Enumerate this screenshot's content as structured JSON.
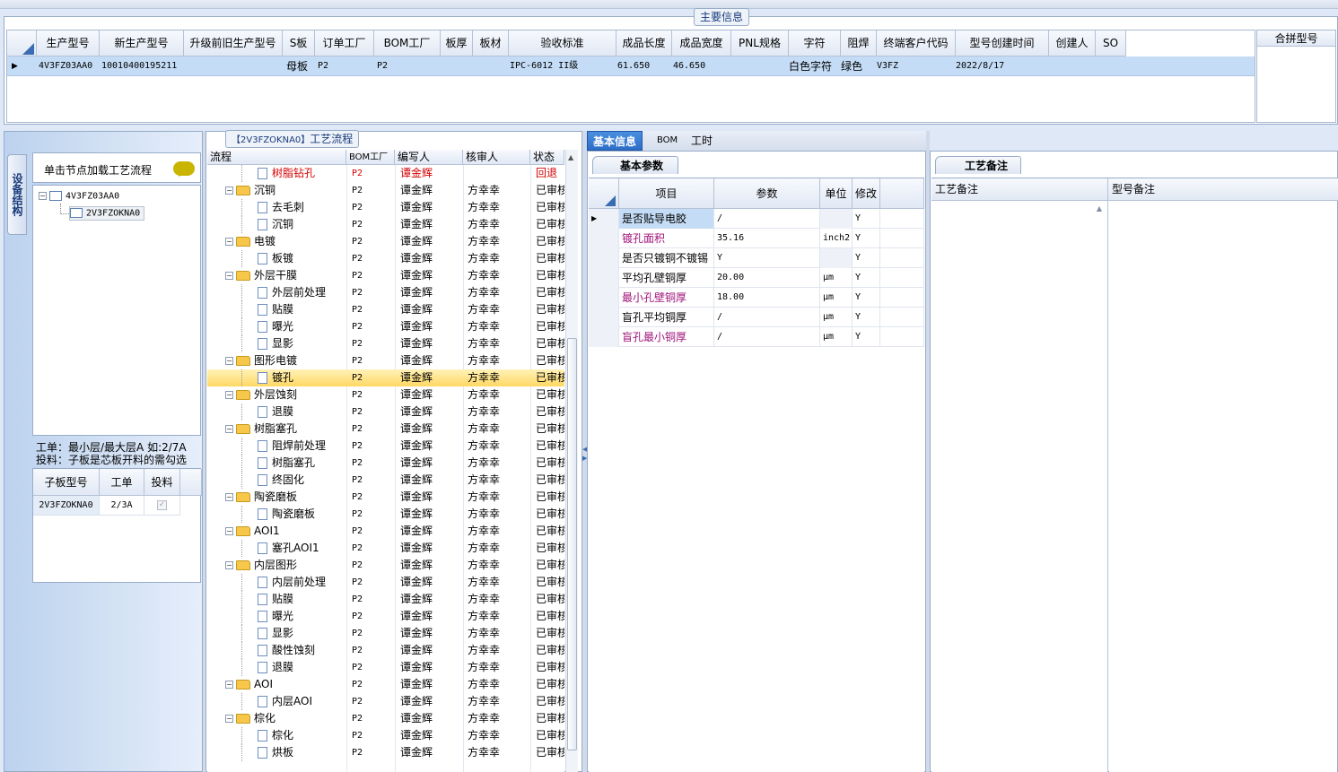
{
  "main": {
    "title": "主要信息",
    "columns": [
      "生产型号",
      "新生产型号",
      "升级前旧生产型号",
      "S板",
      "订单工厂",
      "BOM工厂",
      "板厚",
      "板材",
      "验收标准",
      "成品长度",
      "成品宽度",
      "PNL规格",
      "字符",
      "阻焊",
      "终端客户代码",
      "型号创建时间",
      "创建人",
      "SO"
    ],
    "row": {
      "model": "4V3FZ03AA0",
      "new_model": "10010400195211",
      "s_board": "母板",
      "order_factory": "P2",
      "bom_factory": "P2",
      "standard": "IPC-6012 II级",
      "length": "61.650",
      "width": "46.650",
      "character": "白色字符",
      "solder_mask": "绿色",
      "customer_code": "V3FZ",
      "created": "2022/8/17"
    },
    "merge_label": "合拼型号"
  },
  "left": {
    "vtab": "设备结构",
    "hint": "单击节点加载工艺流程",
    "tree": [
      "4V3FZ03AA0",
      "2V3FZOKNA0"
    ],
    "note_line1": "工单：最小层/最大层A 如:2/7A",
    "note_line2": "投料：子板是芯板开料的需勾选",
    "sub_columns": [
      "子板型号",
      "工单",
      "投料"
    ],
    "sub_row": {
      "model": "2V3FZOKNA0",
      "order": "2/3A"
    }
  },
  "flow": {
    "title_bracket": "【2V3FZOKNA0】",
    "title_text": "工艺流程",
    "columns": [
      "流程",
      "BOM工厂",
      "编写人",
      "核审人",
      "状态"
    ],
    "rows": [
      {
        "name": "树脂钻孔",
        "folder": false,
        "bom": "P2",
        "writer": "谭金辉",
        "reviewer": "",
        "status": "回退",
        "red": true
      },
      {
        "name": "沉铜",
        "folder": true,
        "bom": "P2",
        "writer": "谭金辉",
        "reviewer": "方幸幸",
        "status": "已审核"
      },
      {
        "name": "去毛刺",
        "folder": false,
        "bom": "P2",
        "writer": "谭金辉",
        "reviewer": "方幸幸",
        "status": "已审核"
      },
      {
        "name": "沉铜",
        "folder": false,
        "bom": "P2",
        "writer": "谭金辉",
        "reviewer": "方幸幸",
        "status": "已审核"
      },
      {
        "name": "电镀",
        "folder": true,
        "bom": "P2",
        "writer": "谭金辉",
        "reviewer": "方幸幸",
        "status": "已审核"
      },
      {
        "name": "板镀",
        "folder": false,
        "bom": "P2",
        "writer": "谭金辉",
        "reviewer": "方幸幸",
        "status": "已审核"
      },
      {
        "name": "外层干膜",
        "folder": true,
        "bom": "P2",
        "writer": "谭金辉",
        "reviewer": "方幸幸",
        "status": "已审核"
      },
      {
        "name": "外层前处理",
        "folder": false,
        "bom": "P2",
        "writer": "谭金辉",
        "reviewer": "方幸幸",
        "status": "已审核"
      },
      {
        "name": "贴膜",
        "folder": false,
        "bom": "P2",
        "writer": "谭金辉",
        "reviewer": "方幸幸",
        "status": "已审核"
      },
      {
        "name": "曝光",
        "folder": false,
        "bom": "P2",
        "writer": "谭金辉",
        "reviewer": "方幸幸",
        "status": "已审核"
      },
      {
        "name": "显影",
        "folder": false,
        "bom": "P2",
        "writer": "谭金辉",
        "reviewer": "方幸幸",
        "status": "已审核"
      },
      {
        "name": "图形电镀",
        "folder": true,
        "bom": "P2",
        "writer": "谭金辉",
        "reviewer": "方幸幸",
        "status": "已审核"
      },
      {
        "name": "镀孔",
        "folder": false,
        "bom": "P2",
        "writer": "谭金辉",
        "reviewer": "方幸幸",
        "status": "已审核",
        "selected": true
      },
      {
        "name": "外层蚀刻",
        "folder": true,
        "bom": "P2",
        "writer": "谭金辉",
        "reviewer": "方幸幸",
        "status": "已审核"
      },
      {
        "name": "退膜",
        "folder": false,
        "bom": "P2",
        "writer": "谭金辉",
        "reviewer": "方幸幸",
        "status": "已审核"
      },
      {
        "name": "树脂塞孔",
        "folder": true,
        "bom": "P2",
        "writer": "谭金辉",
        "reviewer": "方幸幸",
        "status": "已审核"
      },
      {
        "name": "阻焊前处理",
        "folder": false,
        "bom": "P2",
        "writer": "谭金辉",
        "reviewer": "方幸幸",
        "status": "已审核"
      },
      {
        "name": "树脂塞孔",
        "folder": false,
        "bom": "P2",
        "writer": "谭金辉",
        "reviewer": "方幸幸",
        "status": "已审核"
      },
      {
        "name": "终固化",
        "folder": false,
        "bom": "P2",
        "writer": "谭金辉",
        "reviewer": "方幸幸",
        "status": "已审核"
      },
      {
        "name": "陶瓷磨板",
        "folder": true,
        "bom": "P2",
        "writer": "谭金辉",
        "reviewer": "方幸幸",
        "status": "已审核"
      },
      {
        "name": "陶瓷磨板",
        "folder": false,
        "bom": "P2",
        "writer": "谭金辉",
        "reviewer": "方幸幸",
        "status": "已审核"
      },
      {
        "name": "AOI1",
        "folder": true,
        "bom": "P2",
        "writer": "谭金辉",
        "reviewer": "方幸幸",
        "status": "已审核"
      },
      {
        "name": "塞孔AOI1",
        "folder": false,
        "bom": "P2",
        "writer": "谭金辉",
        "reviewer": "方幸幸",
        "status": "已审核"
      },
      {
        "name": "内层图形",
        "folder": true,
        "bom": "P2",
        "writer": "谭金辉",
        "reviewer": "方幸幸",
        "status": "已审核"
      },
      {
        "name": "内层前处理",
        "folder": false,
        "bom": "P2",
        "writer": "谭金辉",
        "reviewer": "方幸幸",
        "status": "已审核"
      },
      {
        "name": "贴膜",
        "folder": false,
        "bom": "P2",
        "writer": "谭金辉",
        "reviewer": "方幸幸",
        "status": "已审核"
      },
      {
        "name": "曝光",
        "folder": false,
        "bom": "P2",
        "writer": "谭金辉",
        "reviewer": "方幸幸",
        "status": "已审核"
      },
      {
        "name": "显影",
        "folder": false,
        "bom": "P2",
        "writer": "谭金辉",
        "reviewer": "方幸幸",
        "status": "已审核"
      },
      {
        "name": "酸性蚀刻",
        "folder": false,
        "bom": "P2",
        "writer": "谭金辉",
        "reviewer": "方幸幸",
        "status": "已审核"
      },
      {
        "name": "退膜",
        "folder": false,
        "bom": "P2",
        "writer": "谭金辉",
        "reviewer": "方幸幸",
        "status": "已审核"
      },
      {
        "name": "AOI",
        "folder": true,
        "bom": "P2",
        "writer": "谭金辉",
        "reviewer": "方幸幸",
        "status": "已审核"
      },
      {
        "name": "内层AOI",
        "folder": false,
        "bom": "P2",
        "writer": "谭金辉",
        "reviewer": "方幸幸",
        "status": "已审核"
      },
      {
        "name": "棕化",
        "folder": true,
        "bom": "P2",
        "writer": "谭金辉",
        "reviewer": "方幸幸",
        "status": "已审核"
      },
      {
        "name": "棕化",
        "folder": false,
        "bom": "P2",
        "writer": "谭金辉",
        "reviewer": "方幸幸",
        "status": "已审核"
      },
      {
        "name": "烘板",
        "folder": false,
        "bom": "P2",
        "writer": "谭金辉",
        "reviewer": "方幸幸",
        "status": "已审核"
      }
    ]
  },
  "tabs": [
    "基本信息",
    "BOM",
    "工时"
  ],
  "params": {
    "section": "基本参数",
    "columns": [
      "项目",
      "参数",
      "单位",
      "修改"
    ],
    "rows": [
      {
        "item": "是否贴导电胶",
        "value": "/",
        "unit": "",
        "mod": "Y",
        "pink": false
      },
      {
        "item": "镀孔面积",
        "value": "35.16",
        "unit": "inch2",
        "mod": "Y",
        "pink": true
      },
      {
        "item": "是否只镀铜不镀锡",
        "value": "Y",
        "unit": "",
        "mod": "Y",
        "pink": false
      },
      {
        "item": "平均孔壁铜厚",
        "value": "20.00",
        "unit": "μm",
        "mod": "Y",
        "pink": false
      },
      {
        "item": "最小孔壁铜厚",
        "value": "18.00",
        "unit": "μm",
        "mod": "Y",
        "pink": true
      },
      {
        "item": "盲孔平均铜厚",
        "value": "/",
        "unit": "μm",
        "mod": "Y",
        "pink": false
      },
      {
        "item": "盲孔最小铜厚",
        "value": "/",
        "unit": "μm",
        "mod": "Y",
        "pink": true
      }
    ]
  },
  "remarks": {
    "section": "工艺备注",
    "col1": "工艺备注",
    "col2": "型号备注"
  }
}
